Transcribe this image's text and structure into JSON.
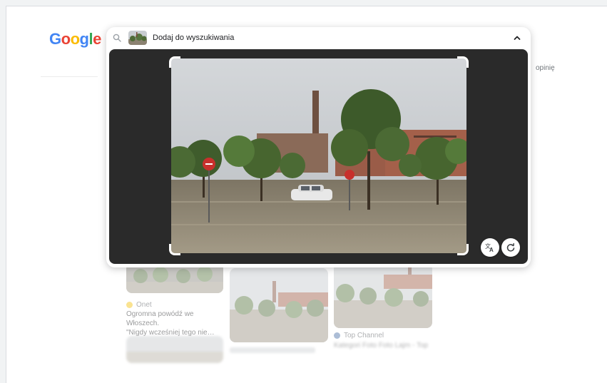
{
  "logo": {
    "letters": [
      "G",
      "o",
      "o",
      "g",
      "l",
      "e"
    ]
  },
  "header": {
    "feedback_text": "opinię"
  },
  "search": {
    "placeholder": "Dodaj do wyszukiwania",
    "icons": {
      "search": "search-icon",
      "collapse": "chevron-up-icon"
    }
  },
  "viewer": {
    "tools": [
      {
        "name": "translate",
        "icon": "translate-icon"
      },
      {
        "name": "rotate",
        "icon": "rotate-icon"
      }
    ]
  },
  "results": [
    {
      "source": "Onet",
      "source_color": "#f4c20d",
      "title_line1": "Ogromna powódź we Włoszech.",
      "title_line2": "\"Nigdy wcześniej tego nie…"
    },
    {
      "source": "Top Channel",
      "source_color": "#4a6fa5",
      "title_line1": "Kategori Foto Foto Lajm - Top"
    }
  ],
  "colors": {
    "viewer_bg": "#2a2a2a",
    "water": "#8b8271",
    "sky": "#c9cdd0"
  }
}
